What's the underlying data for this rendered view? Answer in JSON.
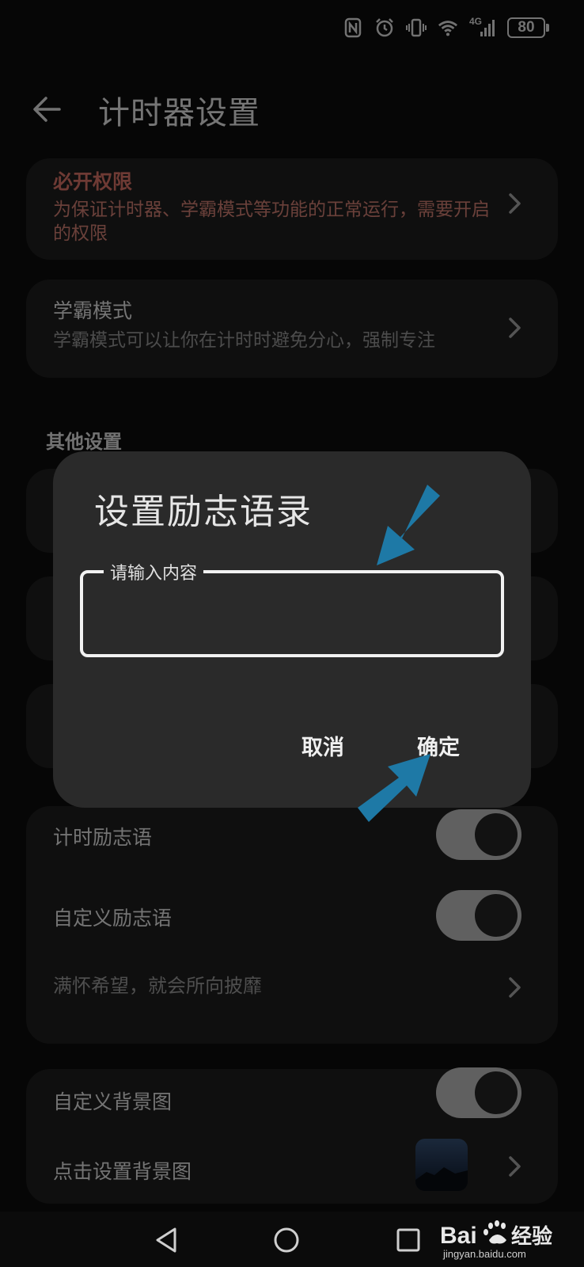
{
  "status_bar": {
    "network": "4G",
    "battery": "80"
  },
  "header": {
    "title": "计时器设置"
  },
  "permissions": {
    "title": "必开权限",
    "description": "为保证计时器、学霸模式等功能的正常运行，需要开启的权限"
  },
  "study_mode": {
    "title": "学霸模式",
    "description": "学霸模式可以让你在计时时避免分心，强制专注"
  },
  "other_settings": {
    "section_label": "其他设置"
  },
  "motto_card": {
    "timer_motto_label": "计时励志语",
    "timer_motto_on": true,
    "custom_motto_label": "自定义励志语",
    "custom_motto_on": true,
    "current_motto": "满怀希望，就会所向披靡"
  },
  "background_card": {
    "custom_bg_label": "自定义背景图",
    "custom_bg_on": true,
    "set_bg_label": "点击设置背景图"
  },
  "dialog": {
    "title": "设置励志语录",
    "input_label": "请输入内容",
    "input_value": "",
    "cancel_label": "取消",
    "confirm_label": "确定"
  },
  "watermark": {
    "brand": "Bai",
    "brand_cn": "经验",
    "url": "jingyan.baidu.com"
  },
  "colors": {
    "accent_warning": "#c96a5f",
    "arrow": "#1e79a6",
    "dialog_bg": "#2a2a2a",
    "card_bg": "#1c1c1c"
  }
}
